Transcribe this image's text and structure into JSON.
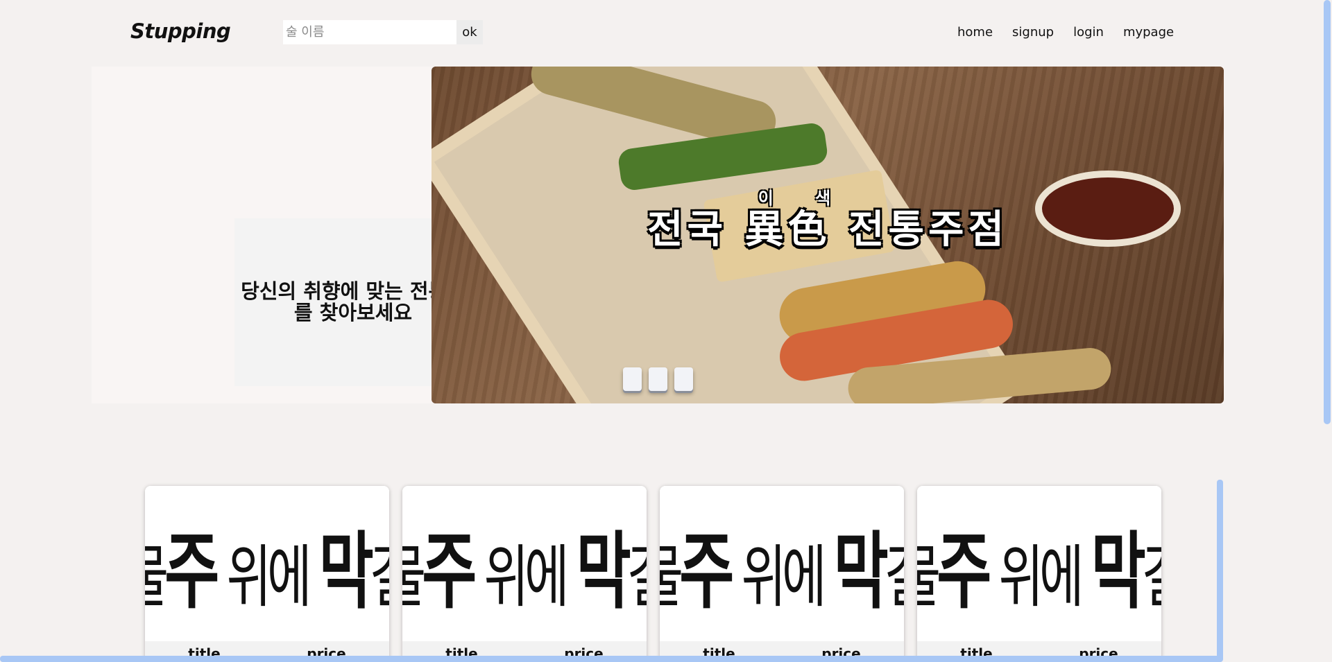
{
  "header": {
    "logo": "Stupping",
    "search": {
      "placeholder": "술 이름",
      "value": "",
      "button_label": "ok"
    },
    "nav": [
      {
        "label": "home"
      },
      {
        "label": "signup"
      },
      {
        "label": "login"
      },
      {
        "label": "mypage"
      }
    ]
  },
  "hero": {
    "tagline": "당신의 취향에 맞는 전통주를 찾아보세요",
    "slide": {
      "title": "전국 異色 전통주점",
      "subtitle": "이 색",
      "dots": 3
    }
  },
  "products": [
    {
      "image_text_a": "조물",
      "image_bold_a": "주",
      "image_text_b": "위에",
      "image_bold_b": "막",
      "image_text_c": "걸리",
      "title": "title",
      "price": "price"
    },
    {
      "image_text_a": "조물",
      "image_bold_a": "주",
      "image_text_b": "위에",
      "image_bold_b": "막",
      "image_text_c": "걸리",
      "title": "title",
      "price": "price"
    },
    {
      "image_text_a": "조물",
      "image_bold_a": "주",
      "image_text_b": "위에",
      "image_bold_b": "막",
      "image_text_c": "걸리",
      "title": "title",
      "price": "price"
    },
    {
      "image_text_a": "조물",
      "image_bold_a": "주",
      "image_text_b": "위에",
      "image_bold_b": "막",
      "image_text_c": "걸리",
      "title": "title",
      "price": "price"
    }
  ],
  "colors": {
    "background": "#f4f1f0",
    "scrollbar": "#a8c7f5"
  }
}
